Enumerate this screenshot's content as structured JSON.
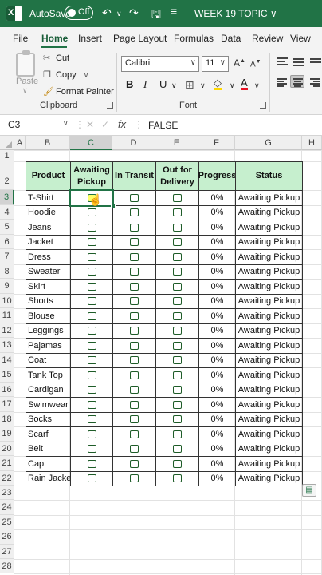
{
  "titlebar": {
    "autosave_label": "AutoSave",
    "toggle_state": "Off",
    "document_title": "WEEK 19 TOPIC ∨"
  },
  "tabs": [
    "File",
    "Home",
    "Insert",
    "Page Layout",
    "Formulas",
    "Data",
    "Review",
    "View"
  ],
  "ribbon": {
    "clipboard": {
      "paste_label": "Paste",
      "cut_label": "Cut",
      "copy_label": "Copy",
      "format_painter_label": "Format Painter",
      "group_label": "Clipboard"
    },
    "font": {
      "font_name": "Calibri",
      "font_size": "11",
      "group_label": "Font",
      "bold": "B",
      "italic": "I",
      "underline": "U"
    }
  },
  "formula_bar": {
    "name_box": "C3",
    "fx": "fx",
    "value": "FALSE"
  },
  "grid": {
    "columns": [
      "A",
      "B",
      "C",
      "D",
      "E",
      "F",
      "G",
      "H"
    ],
    "rows": [
      "1",
      "2",
      "3",
      "4",
      "5",
      "6",
      "7",
      "8",
      "9",
      "10",
      "11",
      "12",
      "13",
      "14",
      "15",
      "16",
      "17",
      "18",
      "19",
      "20",
      "21",
      "22",
      "23",
      "24",
      "25",
      "26",
      "27",
      "28"
    ],
    "selected_column": "C",
    "selected_row": "3"
  },
  "table": {
    "headers": {
      "product": "Product",
      "awaiting": "Awaiting Pickup",
      "in_transit": "In Transit",
      "out_for_delivery": "Out for Delivery",
      "progress": "Progress",
      "status": "Status"
    },
    "rows": [
      {
        "product": "T-Shirt",
        "progress": "0%",
        "status": "Awaiting Pickup"
      },
      {
        "product": "Hoodie",
        "progress": "0%",
        "status": "Awaiting Pickup"
      },
      {
        "product": "Jeans",
        "progress": "0%",
        "status": "Awaiting Pickup"
      },
      {
        "product": "Jacket",
        "progress": "0%",
        "status": "Awaiting Pickup"
      },
      {
        "product": "Dress",
        "progress": "0%",
        "status": "Awaiting Pickup"
      },
      {
        "product": "Sweater",
        "progress": "0%",
        "status": "Awaiting Pickup"
      },
      {
        "product": "Skirt",
        "progress": "0%",
        "status": "Awaiting Pickup"
      },
      {
        "product": "Shorts",
        "progress": "0%",
        "status": "Awaiting Pickup"
      },
      {
        "product": "Blouse",
        "progress": "0%",
        "status": "Awaiting Pickup"
      },
      {
        "product": "Leggings",
        "progress": "0%",
        "status": "Awaiting Pickup"
      },
      {
        "product": "Pajamas",
        "progress": "0%",
        "status": "Awaiting Pickup"
      },
      {
        "product": "Coat",
        "progress": "0%",
        "status": "Awaiting Pickup"
      },
      {
        "product": "Tank Top",
        "progress": "0%",
        "status": "Awaiting Pickup"
      },
      {
        "product": "Cardigan",
        "progress": "0%",
        "status": "Awaiting Pickup"
      },
      {
        "product": "Swimwear",
        "progress": "0%",
        "status": "Awaiting Pickup"
      },
      {
        "product": "Socks",
        "progress": "0%",
        "status": "Awaiting Pickup"
      },
      {
        "product": "Scarf",
        "progress": "0%",
        "status": "Awaiting Pickup"
      },
      {
        "product": "Belt",
        "progress": "0%",
        "status": "Awaiting Pickup"
      },
      {
        "product": "Cap",
        "progress": "0%",
        "status": "Awaiting Pickup"
      },
      {
        "product": "Rain Jacket",
        "progress": "0%",
        "status": "Awaiting Pickup"
      }
    ]
  },
  "colors": {
    "excel_green": "#217346",
    "header_fill": "#c6efce"
  }
}
